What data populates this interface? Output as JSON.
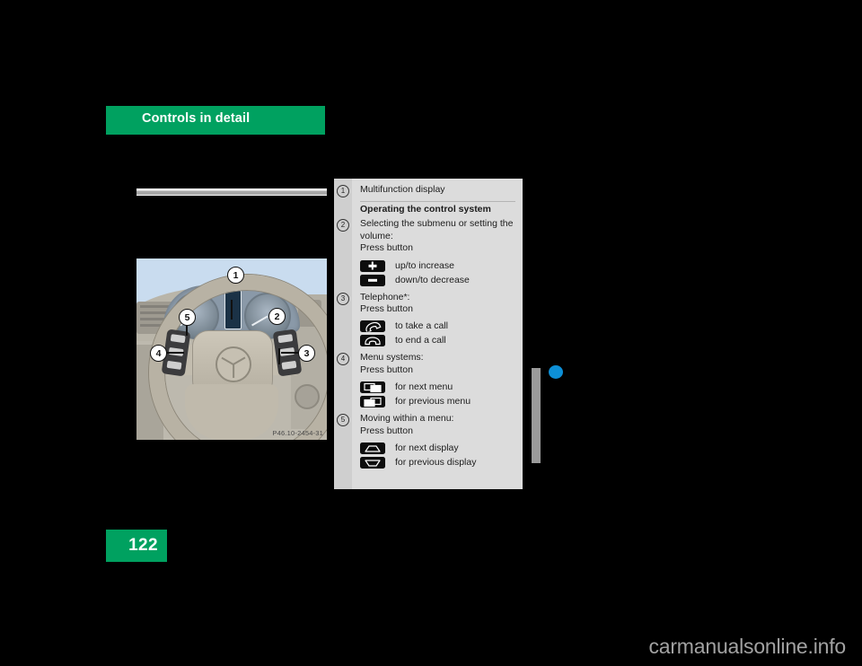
{
  "document": {
    "chapter_title": "Controls in detail",
    "page_number": "122",
    "watermark": "carmanualsonline.info"
  },
  "figure": {
    "caption": "P46.10-2454-31",
    "callouts": [
      "1",
      "2",
      "3",
      "4",
      "5"
    ]
  },
  "legend": {
    "entries": [
      {
        "number": "1",
        "title": "Multifunction display",
        "items": []
      },
      {
        "number": "",
        "title": "Operating the control system",
        "bold": true,
        "items": []
      },
      {
        "number": "2",
        "title": "Selecting the submenu or setting the volume:",
        "subtitle": "Press button",
        "items": [
          {
            "icon": "plus-button-icon",
            "label": "up/to increase"
          },
          {
            "icon": "minus-button-icon",
            "label": "down/to decrease"
          }
        ]
      },
      {
        "number": "3",
        "title": "Telephone*:",
        "subtitle": "Press button",
        "items": [
          {
            "icon": "phone-pickup-icon",
            "label": "to take a call"
          },
          {
            "icon": "phone-hangup-icon",
            "label": "to end a call"
          }
        ]
      },
      {
        "number": "4",
        "title": "Menu systems:",
        "subtitle": "Press button",
        "items": [
          {
            "icon": "next-menu-icon",
            "label": "for next menu"
          },
          {
            "icon": "previous-menu-icon",
            "label": "for previous menu"
          }
        ]
      },
      {
        "number": "5",
        "title": "Moving within a menu:",
        "subtitle": "Press button",
        "items": [
          {
            "icon": "arrow-up-icon",
            "label": "for next display"
          },
          {
            "icon": "arrow-down-icon",
            "label": "for previous display"
          }
        ]
      }
    ]
  },
  "colors": {
    "brand_green": "#00a160",
    "margin_dot_blue": "#0d8fd6",
    "panel_gray": "#dcdcdc"
  }
}
